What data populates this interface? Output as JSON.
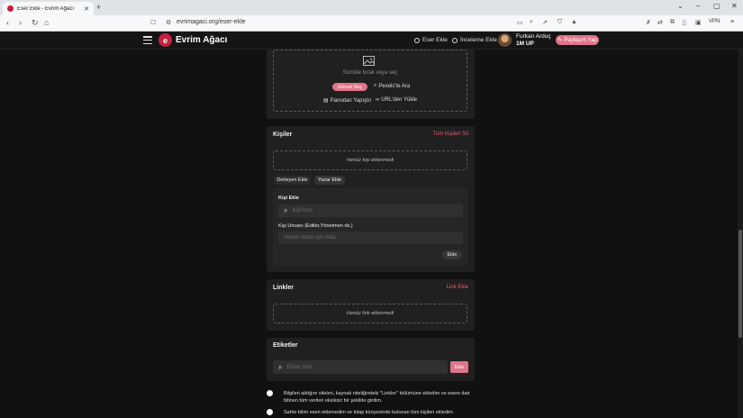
{
  "browser": {
    "tab_title": "Eser Ekle - Evrim Ağacı",
    "url": "evrimagaci.org/eser-ekle",
    "vpn_label": "VPN"
  },
  "header": {
    "brand": "Evrim Ağacı",
    "logo_letter": "e",
    "links": [
      "Eser Ekle",
      "İnceleme Ekle"
    ],
    "user_name": "Furkan Arduç",
    "user_badge": "1M UP",
    "share_label": "Paylaşım Yap"
  },
  "upload": {
    "dropzone_text": "Sürükle bırak veya seç",
    "select_image": "Görsel Seç",
    "pexels_search": "Pexels'te Ara",
    "paste_clipboard": "Panodan Yapıştır",
    "load_url": "URL'den Yükle"
  },
  "people": {
    "title": "Kişiler",
    "clear_all": "Tüm Kişileri Sil",
    "empty": "Henüz kişi eklenmedi",
    "tabs": [
      "Derleyen Ekle",
      "Yazar Ekle"
    ],
    "add_person_label": "Kişi Ekle",
    "person_placeholder": "Kişi İsmi",
    "title_label": "Kişi Unvanı (Editör,Yönetmen vb.)",
    "title_placeholder": "Unvan listesi için tıkla",
    "add_button": "Ekle"
  },
  "links": {
    "title": "Linkler",
    "add_link": "Link Ekle",
    "empty": "Henüz link eklenmedi"
  },
  "tags": {
    "title": "Etiketler",
    "placeholder": "Etiket İsmi",
    "add_button": "Ekle"
  },
  "checks": [
    "Bilgileri aldığım siteleri, kaynak niteliğindeki \"Linkler\" bölümüne ekledim ve esere dair bilinen tüm verileri eksiksiz bir şekilde girdim.",
    "Sahte bilim eseri eklemedim ve kitap künyesinde bulunan tüm kişileri ekledim."
  ],
  "colors": {
    "accent": "#e0748a",
    "link_red": "#e35c73",
    "background": "#111111",
    "card": "#202020"
  }
}
